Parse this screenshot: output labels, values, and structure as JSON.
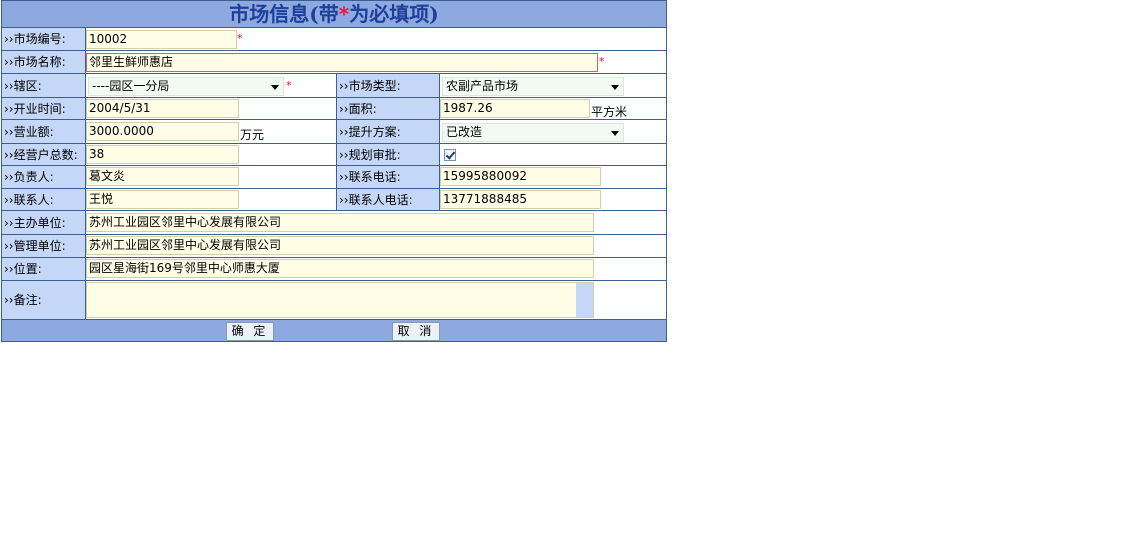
{
  "title": {
    "prefix": "市场信息(带",
    "star": "*",
    "suffix": "为必填项)"
  },
  "required_mark": "*",
  "fields": {
    "market_no": {
      "label": "››市场编号:",
      "value": "10002"
    },
    "market_name": {
      "label": "››市场名称:",
      "value": "邻里生鲜师惠店"
    },
    "district": {
      "label": "››辖区:",
      "value": "----园区一分局"
    },
    "market_type": {
      "label": "››市场类型:",
      "value": "农副产品市场"
    },
    "open_date": {
      "label": "››开业时间:",
      "value": "2004/5/31"
    },
    "area": {
      "label": "››面积:",
      "value": "1987.26",
      "unit": "平方米"
    },
    "revenue": {
      "label": "››营业额:",
      "value": "3000.0000",
      "unit": "万元"
    },
    "upgrade_plan": {
      "label": "››提升方案:",
      "value": "已改造"
    },
    "vendor_count": {
      "label": "››经营户总数:",
      "value": "38"
    },
    "plan_approval": {
      "label": "››规划审批:",
      "checked": true
    },
    "manager": {
      "label": "››负责人:",
      "value": "葛文炎"
    },
    "phone": {
      "label": "››联系电话:",
      "value": "15995880092"
    },
    "contact": {
      "label": "››联系人:",
      "value": "王悦"
    },
    "contact_phone": {
      "label": "››联系人电话:",
      "value": "13771888485"
    },
    "sponsor": {
      "label": "››主办单位:",
      "value": "苏州工业园区邻里中心发展有限公司"
    },
    "management": {
      "label": "››管理单位:",
      "value": "苏州工业园区邻里中心发展有限公司"
    },
    "location": {
      "label": "››位置:",
      "value": "园区星海街169号邻里中心师惠大厦"
    },
    "remarks": {
      "label": "››备注:",
      "value": ""
    }
  },
  "buttons": {
    "confirm": "确 定",
    "cancel": "取 消"
  },
  "colors": {
    "header_bg": "#8ea9df",
    "label_bg": "#c5d7f6",
    "input_bg": "#fffde6",
    "border": "#3b5f94",
    "title_text": "#1d3f9a",
    "required": "#ff0033"
  }
}
